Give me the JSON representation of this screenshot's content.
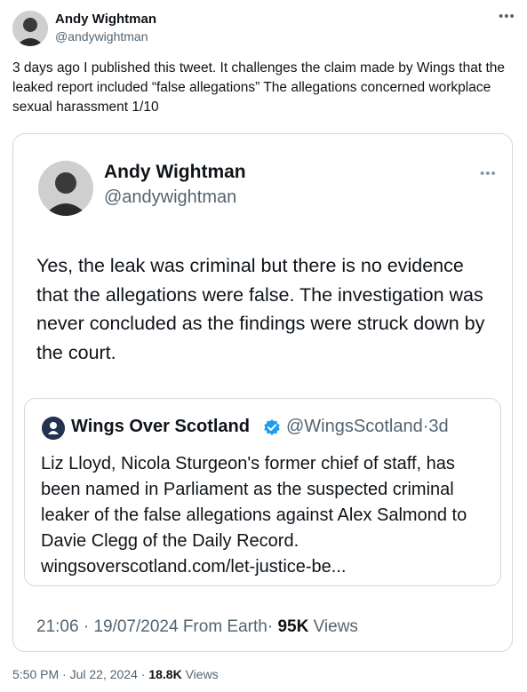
{
  "outer": {
    "author_name": "Andy Wightman",
    "author_handle": "@andywightman",
    "more_icon": "more-horizontal-icon",
    "text": "3 days ago I published this tweet. It challenges the claim made by Wings that the leaked report included “false allegations” The allegations concerned workplace sexual harassment 1/10",
    "time": "5:50 PM",
    "sep": "·",
    "date": "Jul 22, 2024",
    "views_count": "18.8K",
    "views_label": "Views"
  },
  "embedded": {
    "author_name": "Andy Wightman",
    "author_handle": "@andywightman",
    "more_icon": "more-horizontal-icon",
    "text": "Yes, the leak was criminal but there is no evidence that the allegations were false. The investigation was never concluded as the findings were struck down by the court.",
    "time": "21:06",
    "sep": "·",
    "date": "19/07/2024",
    "source": "From Earth",
    "views_count": "95K",
    "views_label": "Views",
    "quote": {
      "author_name": "Wings Over Scotland",
      "verified_icon": "verified-badge-icon",
      "verified_color": "#1d9bf0",
      "author_handle": "@WingsScotland",
      "sep": "·",
      "age": "3d",
      "text": "Liz Lloyd, Nicola Sturgeon's former chief of staff, has been named in Parliament as the suspected criminal leaker of the false allegations against Alex Salmond to Davie Clegg of the Daily Record. wingsoverscotland.com/let-justice-be..."
    }
  }
}
